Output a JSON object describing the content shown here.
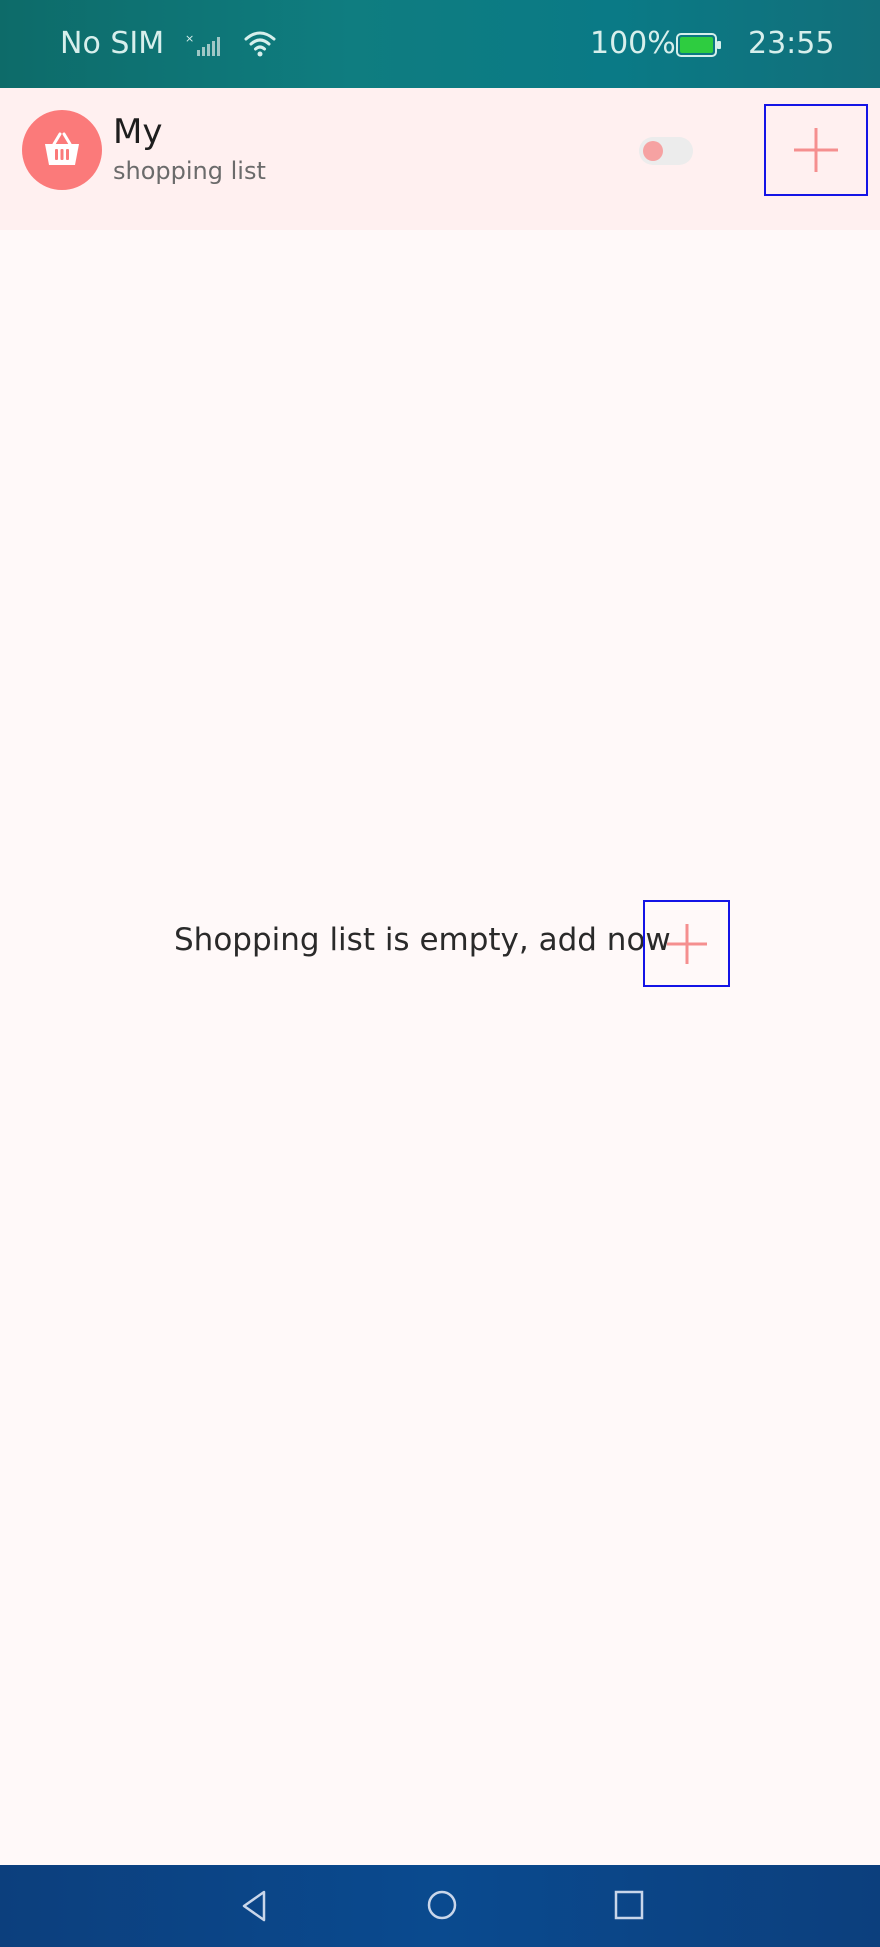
{
  "status_bar": {
    "carrier": "No SIM",
    "battery_percent": "100%",
    "time": "23:55",
    "icons": [
      "signal-icon",
      "wifi-icon",
      "battery-icon"
    ]
  },
  "header": {
    "title": "My",
    "subtitle": "shopping list",
    "logo_icon": "shopping-basket-icon",
    "toggle_on": false,
    "add_icon": "plus-icon"
  },
  "empty_state": {
    "message": "Shopping list is empty, add now",
    "add_icon": "plus-icon"
  },
  "nav_bar": {
    "icons": [
      "back-icon",
      "home-icon",
      "recent-apps-icon"
    ]
  },
  "colors": {
    "accent": "#fb7a7a",
    "header_bg": "#fff0f0",
    "page_bg": "#fff9f9",
    "status_bar": "#0f7d80",
    "nav_bar": "#0a4a8f",
    "highlight_box": "#1414e6"
  }
}
